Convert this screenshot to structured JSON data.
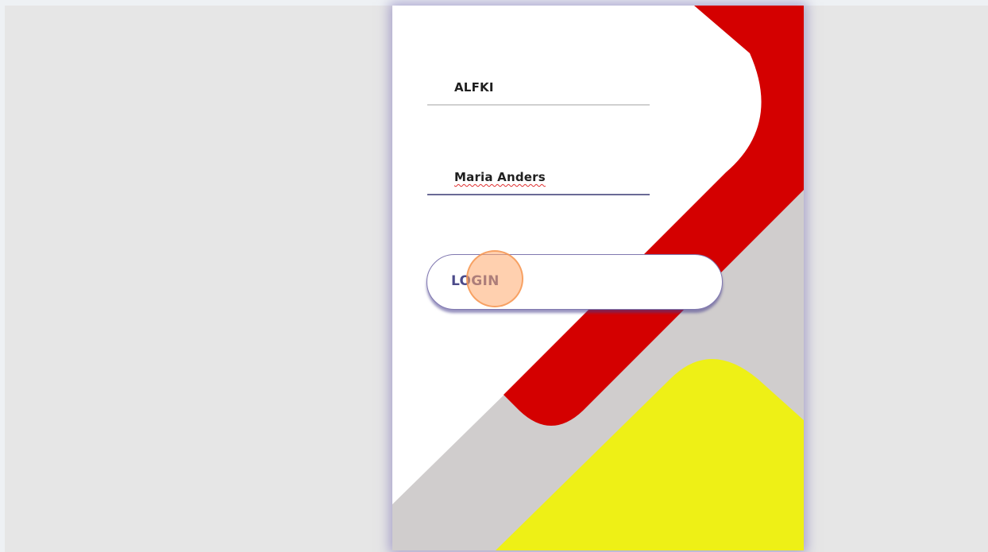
{
  "login_form": {
    "username_value": "ALFKI",
    "password_value": "Maria Anders",
    "login_label": "LOGIN"
  },
  "colors": {
    "page_background": "#e6e6e6",
    "card_background": "#ffffff",
    "accent_red": "#d40000",
    "accent_yellow": "#eef016",
    "accent_gray": "#d0cdcd",
    "button_border": "#8078b0",
    "button_text": "#4b4a8a"
  }
}
